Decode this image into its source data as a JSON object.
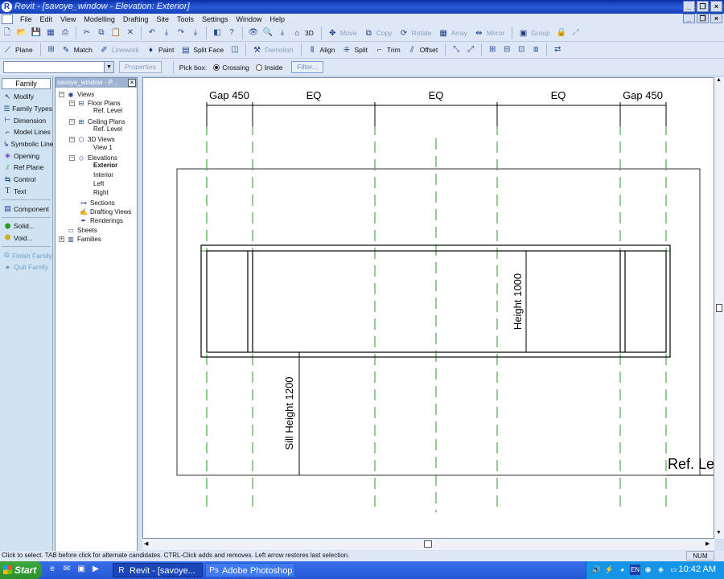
{
  "window": {
    "title": "Revit - [savoye_window - Elevation: Exterior]"
  },
  "menu": [
    "File",
    "Edit",
    "View",
    "Modelling",
    "Drafting",
    "Site",
    "Tools",
    "Settings",
    "Window",
    "Help"
  ],
  "toolbar1": {
    "move": "Move",
    "copy": "Copy",
    "rotate": "Rotate",
    "array": "Array",
    "mirror": "Mirror",
    "group": "Group",
    "view3d": "3D"
  },
  "toolbar2": {
    "plane": "Plane",
    "match": "Match",
    "linework": "Linework",
    "paint": "Paint",
    "split_face": "Split Face",
    "demolish": "Demolish",
    "align": "Align",
    "split": "Split",
    "trim": "Trim",
    "offset": "Offset"
  },
  "toolbar3": {
    "properties": "Properties",
    "pick_box": "Pick box:",
    "crossing": "Crossing",
    "inside": "Inside",
    "filter": "Filter..."
  },
  "design_bar": {
    "tab": "Family",
    "items": [
      "Modify",
      "Family Types",
      "Dimension",
      "Model Lines",
      "Symbolic Line",
      "Opening",
      "Ref Plane",
      "Control",
      "Text"
    ],
    "component": "Component",
    "solid": "Solid...",
    "void": "Void...",
    "finish_family": "Finish Family",
    "quit_family": "Quit Family"
  },
  "browser": {
    "title": "savoye_window - P...",
    "views": "Views",
    "floor_plans": "Floor Plans",
    "fp_ref_level": "Ref. Level",
    "ceiling_plans": "Ceiling Plans",
    "cp_ref_level": "Ref. Level",
    "views_3d": "3D Views",
    "view1": "View 1",
    "elevations": "Elevations",
    "exterior": "Exterior",
    "interior": "Interior",
    "left": "Left",
    "right": "Right",
    "sections": "Sections",
    "drafting_views": "Drafting Views",
    "renderings": "Renderings",
    "sheets": "Sheets",
    "families": "Families"
  },
  "drawing": {
    "dims_top": [
      "Gap 450",
      "EQ",
      "EQ",
      "EQ",
      "Gap 450"
    ],
    "height_label": "Height 1000",
    "sill_label": "Sill Height 1200",
    "ref_level_label": "Ref. Le"
  },
  "status": {
    "message": "Click to select. TAB before click for alternate candidates. CTRL-Click adds and removes. Left arrow restores last selection.",
    "num": "NUM"
  },
  "taskbar": {
    "start": "Start",
    "tasks": [
      "Revit - [savoye...",
      "Adobe Photoshop"
    ],
    "lang": "EN",
    "clock": "10:42 AM"
  },
  "colors": {
    "ref_plane": "#2a9a2a",
    "titlebar": "#0a2fa8",
    "taskbar": "#2457d6",
    "tray": "#1694e6"
  }
}
